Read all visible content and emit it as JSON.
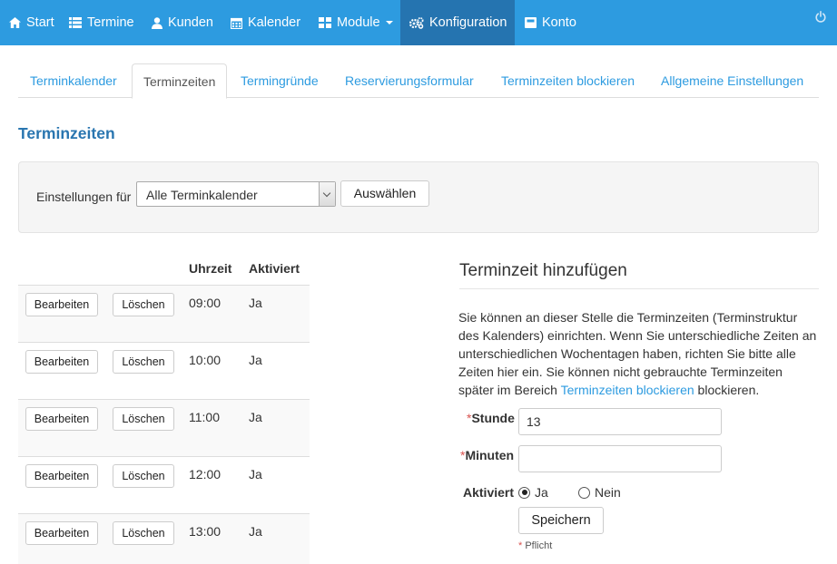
{
  "nav": {
    "items": [
      {
        "label": "Start",
        "icon": "home-icon"
      },
      {
        "label": "Termine",
        "icon": "list-icon"
      },
      {
        "label": "Kunden",
        "icon": "user-icon"
      },
      {
        "label": "Kalender",
        "icon": "calendar-icon"
      },
      {
        "label": "Module",
        "icon": "grid-icon"
      },
      {
        "label": "Konfiguration",
        "icon": "gears-icon"
      },
      {
        "label": "Konto",
        "icon": "inbox-icon"
      }
    ],
    "active": "Konfiguration",
    "colors": {
      "bar": "#2d9be0",
      "active": "#2574b0"
    }
  },
  "tabs": [
    {
      "label": "Terminkalender"
    },
    {
      "label": "Terminzeiten"
    },
    {
      "label": "Termingründe"
    },
    {
      "label": "Reservierungsformular"
    },
    {
      "label": "Terminzeiten blockieren"
    },
    {
      "label": "Allgemeine Einstellungen"
    }
  ],
  "page": {
    "title": "Terminzeiten",
    "settings_label": "Einstellungen für",
    "calendar_select_value": "Alle Terminkalender",
    "select_button": "Auswählen"
  },
  "table": {
    "columns": {
      "time": "Uhrzeit",
      "active": "Aktiviert"
    },
    "edit_label": "Bearbeiten",
    "delete_label": "Löschen",
    "rows": [
      {
        "time": "09:00",
        "active": "Ja"
      },
      {
        "time": "10:00",
        "active": "Ja"
      },
      {
        "time": "11:00",
        "active": "Ja"
      },
      {
        "time": "12:00",
        "active": "Ja"
      },
      {
        "time": "13:00",
        "active": "Ja"
      }
    ]
  },
  "form": {
    "title": "Terminzeit hinzufügen",
    "description_before": "Sie können an dieser Stelle die Terminzeiten (Terminstruktur des Kalenders) einrichten. Wenn Sie unterschiedliche Zeiten an unterschiedlichen Wochentagen haben, richten Sie bitte alle Zeiten hier ein. Sie können nicht gebrauchte Terminzeiten später im Bereich ",
    "description_link": "Terminzeiten blockieren",
    "description_after": " blockieren.",
    "required_mark": "*",
    "hour_label": "Stunde",
    "hour_value": "13",
    "minutes_label": "Minuten",
    "minutes_value": "",
    "active_label": "Aktiviert",
    "radio_yes": "Ja",
    "radio_no": "Nein",
    "save_button": "Speichern",
    "required_note": "Pflicht"
  }
}
